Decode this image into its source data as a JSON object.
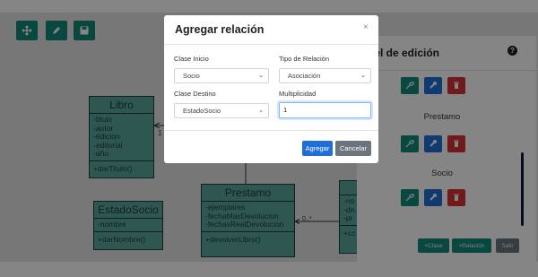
{
  "uml_classes": {
    "libro": {
      "name": "Libro",
      "attributes": [
        "-titulo",
        "-autor",
        "-edicion",
        "-editorial",
        "-año"
      ],
      "methods": [
        "+darTitulo()"
      ]
    },
    "estado_socio": {
      "name": "EstadoSocio",
      "attributes": [
        "-nombre"
      ],
      "methods": [
        "+darNombre()"
      ]
    },
    "prestamo": {
      "name": "Prestamo",
      "attributes": [
        "-ejemplares",
        "-fechaMaxDevolucion",
        "-fechasRealDevolucion"
      ],
      "methods": [
        "+devolverLibro()"
      ]
    },
    "partial": {
      "attributes": [
        "-no",
        "-dn",
        "-pr"
      ],
      "methods": [
        "+cc"
      ]
    }
  },
  "relations": {
    "multiplicity_libro": "1",
    "multiplicity_prestamo": "0..*"
  },
  "panel": {
    "title": "nel de edición",
    "help_symbol": "?",
    "items": [
      {
        "label": "Prestamo"
      },
      {
        "label": "Socio"
      }
    ],
    "footer": {
      "add_class": "+Clase",
      "add_relation": "+Relación",
      "exit": "Salir"
    }
  },
  "modal": {
    "title": "Agregar relación",
    "close_symbol": "×",
    "clase_inicio": {
      "label": "Clase Inicio",
      "value": "Socio"
    },
    "tipo_relacion": {
      "label": "Tipo de Relación",
      "value": "Asociación"
    },
    "clase_destino": {
      "label": "Clase Destino",
      "value": "EstadoSocio"
    },
    "multiplicidad": {
      "label": "Multiplicidad",
      "value": "1"
    },
    "agregar_label": "Agregar",
    "cancelar_label": "Cancelar"
  },
  "colors": {
    "teal": "#128a7a",
    "blue": "#1f6fd6",
    "red": "#d9333b",
    "uml_fill": "#5aa89c"
  },
  "icons": {
    "toolbar": [
      "pointer-icon",
      "pencil-icon",
      "save-icon"
    ],
    "row_actions": [
      "connect-icon",
      "wrench-icon",
      "trash-icon"
    ],
    "chevron": "chevron-down-icon"
  }
}
